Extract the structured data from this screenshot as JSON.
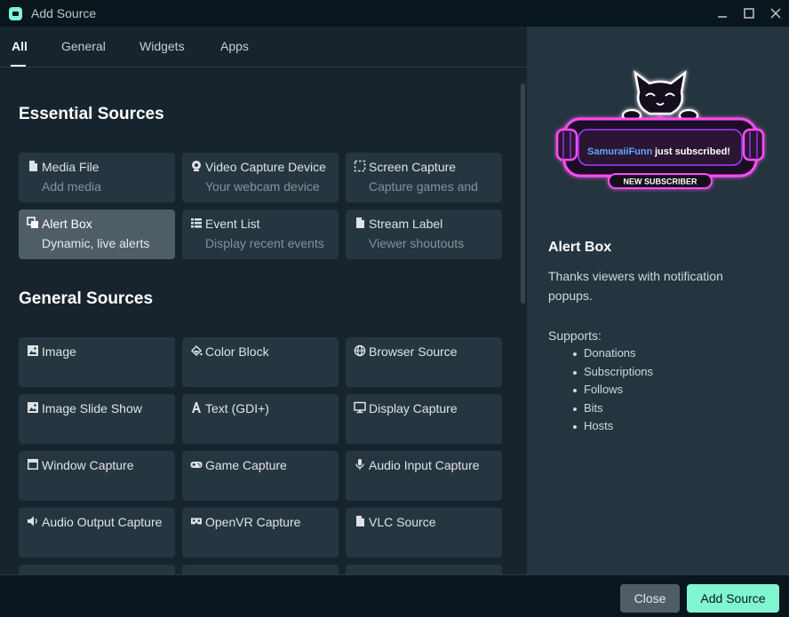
{
  "window": {
    "title": "Add Source"
  },
  "tabs": [
    {
      "label": "All"
    },
    {
      "label": "General"
    },
    {
      "label": "Widgets"
    },
    {
      "label": "Apps"
    }
  ],
  "sections": {
    "essential": {
      "title": "Essential Sources",
      "cards": [
        {
          "title": "Media File",
          "desc": "Add media",
          "icon": "media-file-icon"
        },
        {
          "title": "Video Capture Device",
          "desc": "Your webcam device",
          "icon": "webcam-icon"
        },
        {
          "title": "Screen Capture",
          "desc": "Capture games and",
          "icon": "screen-capture-icon"
        },
        {
          "title": "Alert Box",
          "desc": "Dynamic, live alerts",
          "icon": "alert-box-icon",
          "selected": true
        },
        {
          "title": "Event List",
          "desc": "Display recent events",
          "icon": "event-list-icon"
        },
        {
          "title": "Stream Label",
          "desc": "Viewer shoutouts",
          "icon": "stream-label-icon"
        }
      ]
    },
    "general": {
      "title": "General Sources",
      "cards": [
        {
          "title": "Image",
          "icon": "image-icon"
        },
        {
          "title": "Color Block",
          "icon": "paint-bucket-icon"
        },
        {
          "title": "Browser Source",
          "icon": "globe-icon"
        },
        {
          "title": "Image Slide Show",
          "icon": "slideshow-icon"
        },
        {
          "title": "Text (GDI+)",
          "icon": "text-icon"
        },
        {
          "title": "Display Capture",
          "icon": "monitor-icon"
        },
        {
          "title": "Window Capture",
          "icon": "window-icon"
        },
        {
          "title": "Game Capture",
          "icon": "gamepad-icon"
        },
        {
          "title": "Audio Input Capture",
          "icon": "microphone-icon"
        },
        {
          "title": "Audio Output Capture",
          "icon": "speaker-icon"
        },
        {
          "title": "OpenVR Capture",
          "icon": "vr-headset-icon"
        },
        {
          "title": "VLC Source",
          "icon": "file-icon"
        }
      ]
    }
  },
  "preview": {
    "username": "SamuraiiFunn",
    "message": "just subscribed!",
    "banner": "NEW SUBSCRIBER"
  },
  "detail": {
    "title": "Alert Box",
    "description": "Thanks viewers with notification popups.",
    "supports_label": "Supports:",
    "supports": [
      "Donations",
      "Subscriptions",
      "Follows",
      "Bits",
      "Hosts"
    ]
  },
  "footer": {
    "close_label": "Close",
    "add_label": "Add Source"
  },
  "colors": {
    "accent": "#80f5d2",
    "card": "#263640",
    "card_selected": "#4f5e66",
    "neon_pink": "#ff4df2",
    "neon_purple": "#a23cff"
  }
}
